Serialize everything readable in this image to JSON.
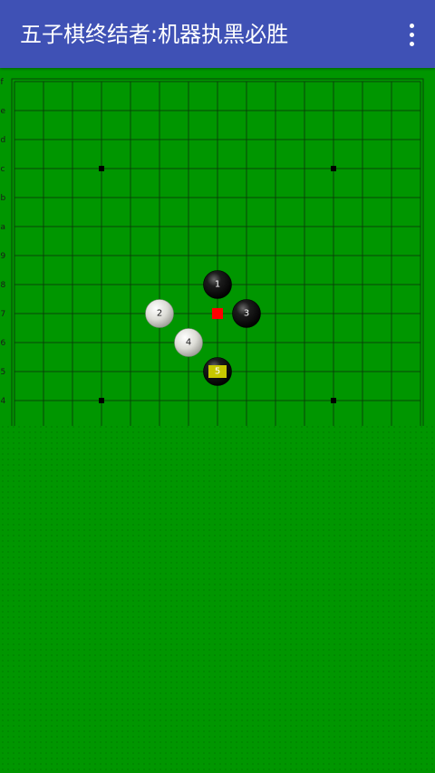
{
  "app": {
    "title": "五子棋终结者:机器执黑必胜",
    "menu_icon": "more-vert-icon"
  },
  "colors": {
    "appbar": "#3f51b5",
    "board_background": "#009600",
    "grid_line": "#0a3a0a",
    "last_move_marker": "#ff0000",
    "highlight_label": "#c8c800"
  },
  "board": {
    "row_labels": [
      "f",
      "e",
      "d",
      "c",
      "b",
      "a",
      "9",
      "8",
      "7",
      "6",
      "5",
      "4"
    ],
    "star_points": [
      {
        "col": 3,
        "row": 3
      },
      {
        "col": 11,
        "row": 3
      },
      {
        "col": 3,
        "row": 11
      },
      {
        "col": 11,
        "row": 11
      }
    ],
    "stones": [
      {
        "number": "1",
        "color": "black",
        "col": 7,
        "row": 7
      },
      {
        "number": "2",
        "color": "white",
        "col": 5,
        "row": 8
      },
      {
        "number": "3",
        "color": "black",
        "col": 8,
        "row": 8
      },
      {
        "number": "4",
        "color": "white",
        "col": 6,
        "row": 9
      },
      {
        "number": "5",
        "color": "black",
        "col": 7,
        "row": 10,
        "highlight": true
      }
    ],
    "last_move_marker": {
      "col": 7,
      "row": 8
    }
  }
}
